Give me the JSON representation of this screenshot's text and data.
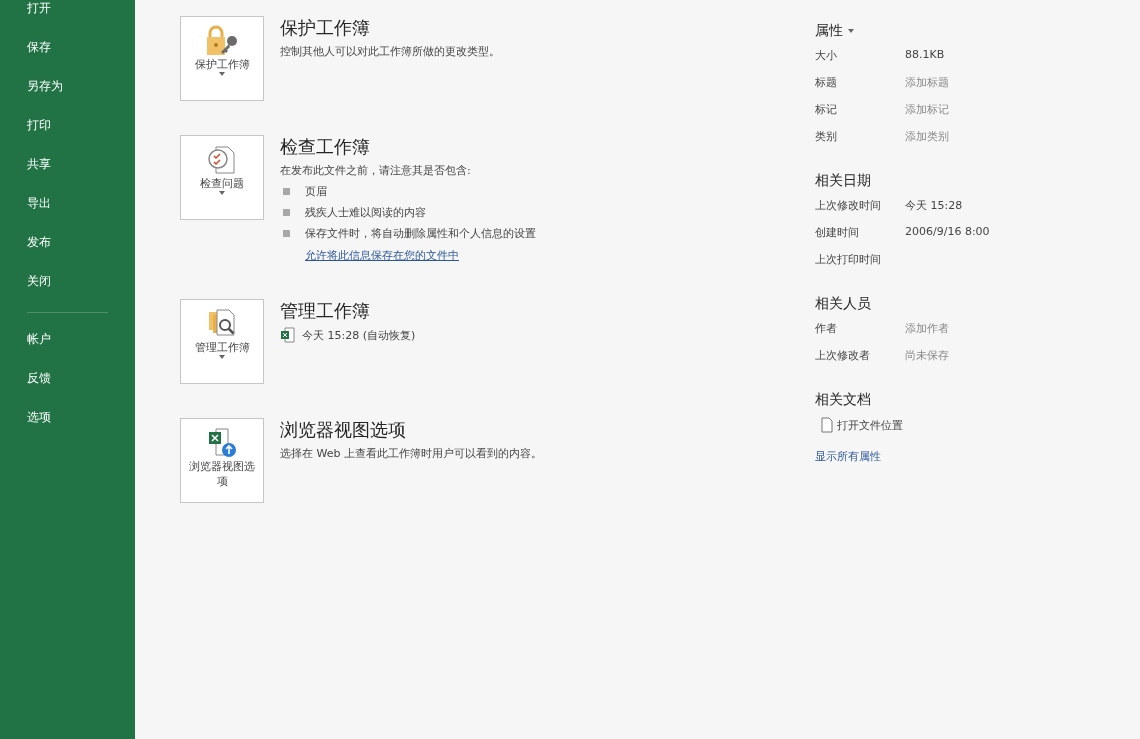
{
  "sidebar": {
    "items": [
      {
        "label": "打开"
      },
      {
        "label": "保存"
      },
      {
        "label": "另存为"
      },
      {
        "label": "打印"
      },
      {
        "label": "共享"
      },
      {
        "label": "导出"
      },
      {
        "label": "发布"
      },
      {
        "label": "关闭"
      }
    ],
    "lower_items": [
      {
        "label": "帐户"
      },
      {
        "label": "反馈"
      },
      {
        "label": "选项"
      }
    ]
  },
  "sections": [
    {
      "kind": "protect",
      "button": {
        "label": "保护工作簿",
        "dropdown": true
      },
      "title": "保护工作簿",
      "description": "控制其他人可以对此工作簿所做的更改类型。"
    },
    {
      "kind": "inspect",
      "button": {
        "label": "检查问题",
        "dropdown": true
      },
      "title": "检查工作簿",
      "description": "在发布此文件之前，请注意其是否包含:",
      "bullets": [
        "页眉",
        "残疾人士难以阅读的内容",
        "保存文件时，将自动删除属性和个人信息的设置"
      ],
      "link": "允许将此信息保存在您的文件中"
    },
    {
      "kind": "manage",
      "button": {
        "label": "管理工作簿",
        "dropdown": true
      },
      "title": "管理工作簿",
      "versions": [
        "今天 15:28 (自动恢复)"
      ]
    },
    {
      "kind": "browser",
      "button": {
        "label": "浏览器视图选项",
        "dropdown": false
      },
      "title": "浏览器视图选项",
      "description": "选择在 Web 上查看此工作簿时用户可以看到的内容。"
    }
  ],
  "properties": {
    "title": "属性",
    "groups": [
      {
        "rows": [
          {
            "label": "大小",
            "value": "88.1KB"
          },
          {
            "label": "标题",
            "placeholder": "添加标题"
          },
          {
            "label": "标记",
            "placeholder": "添加标记"
          },
          {
            "label": "类别",
            "placeholder": "添加类别"
          }
        ]
      },
      {
        "title": "相关日期",
        "rows": [
          {
            "label": "上次修改时间",
            "value": "今天 15:28"
          },
          {
            "label": "创建时间",
            "value": "2006/9/16 8:00"
          },
          {
            "label": "上次打印时间"
          }
        ]
      },
      {
        "title": "相关人员",
        "rows": [
          {
            "label": "作者",
            "placeholder": "添加作者"
          },
          {
            "label": "上次修改者",
            "placeholder": "尚未保存"
          }
        ]
      },
      {
        "title": "相关文档"
      }
    ],
    "open_location": "打开文件位置",
    "show_all": "显示所有属性"
  }
}
